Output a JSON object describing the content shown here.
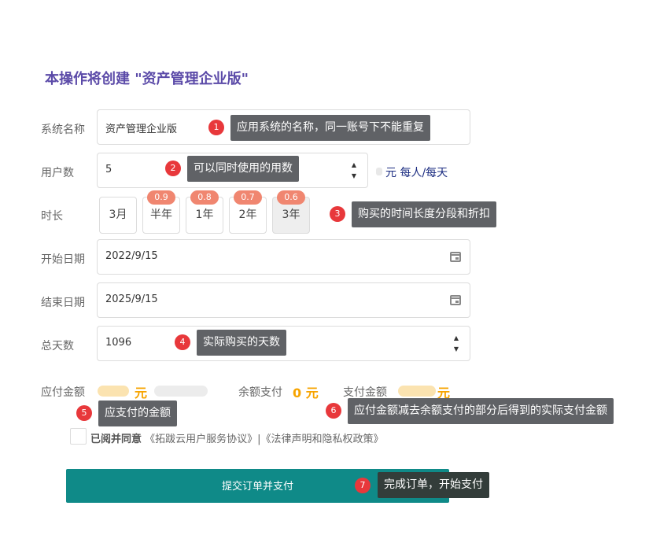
{
  "page_title": "本操作将创建 \"资产管理企业版\"",
  "fields": {
    "system_name": {
      "label": "系统名称",
      "value": "资产管理企业版"
    },
    "user_count": {
      "label": "用户数",
      "value": "5",
      "unit_price_suffix": "元 每人/每天"
    },
    "duration": {
      "label": "时长",
      "options": [
        {
          "label": "3月",
          "discount": ""
        },
        {
          "label": "半年",
          "discount": "0.9"
        },
        {
          "label": "1年",
          "discount": "0.8"
        },
        {
          "label": "2年",
          "discount": "0.7"
        },
        {
          "label": "3年",
          "discount": "0.6"
        }
      ],
      "selected": "3年"
    },
    "start_date": {
      "label": "开始日期",
      "value": "2022/9/15"
    },
    "end_date": {
      "label": "结束日期",
      "value": "2025/9/15"
    },
    "total_days": {
      "label": "总天数",
      "value": "1096"
    }
  },
  "payment": {
    "payable_label": "应付金额",
    "payable_unit": "元",
    "balance_label": "余额支付",
    "balance_value": "0 元",
    "pay_label": "支付金额",
    "pay_unit": "元"
  },
  "agreement": {
    "prefix": "已阅并同意",
    "links": "《拓跋云用户服务协议》|《法律声明和隐私权政策》"
  },
  "submit_label": "提交订单并支付",
  "annotations": [
    {
      "num": "1",
      "text": "应用系统的名称，同一账号下不能重复"
    },
    {
      "num": "2",
      "text": "可以同时使用的用数"
    },
    {
      "num": "3",
      "text": "购买的时间长度分段和折扣"
    },
    {
      "num": "4",
      "text": "实际购买的天数"
    },
    {
      "num": "5",
      "text": "应支付的金额"
    },
    {
      "num": "6",
      "text": "应付金额减去余额支付的部分后得到的实际支付金额"
    },
    {
      "num": "7",
      "text": "完成订单，开始支付"
    }
  ],
  "colors": {
    "title": "#5b4aa8",
    "price": "#f7a400",
    "submit_bg": "#0f8a88",
    "badge": "#e8383b",
    "discount": "#f08670",
    "tooltip": "#606266"
  }
}
